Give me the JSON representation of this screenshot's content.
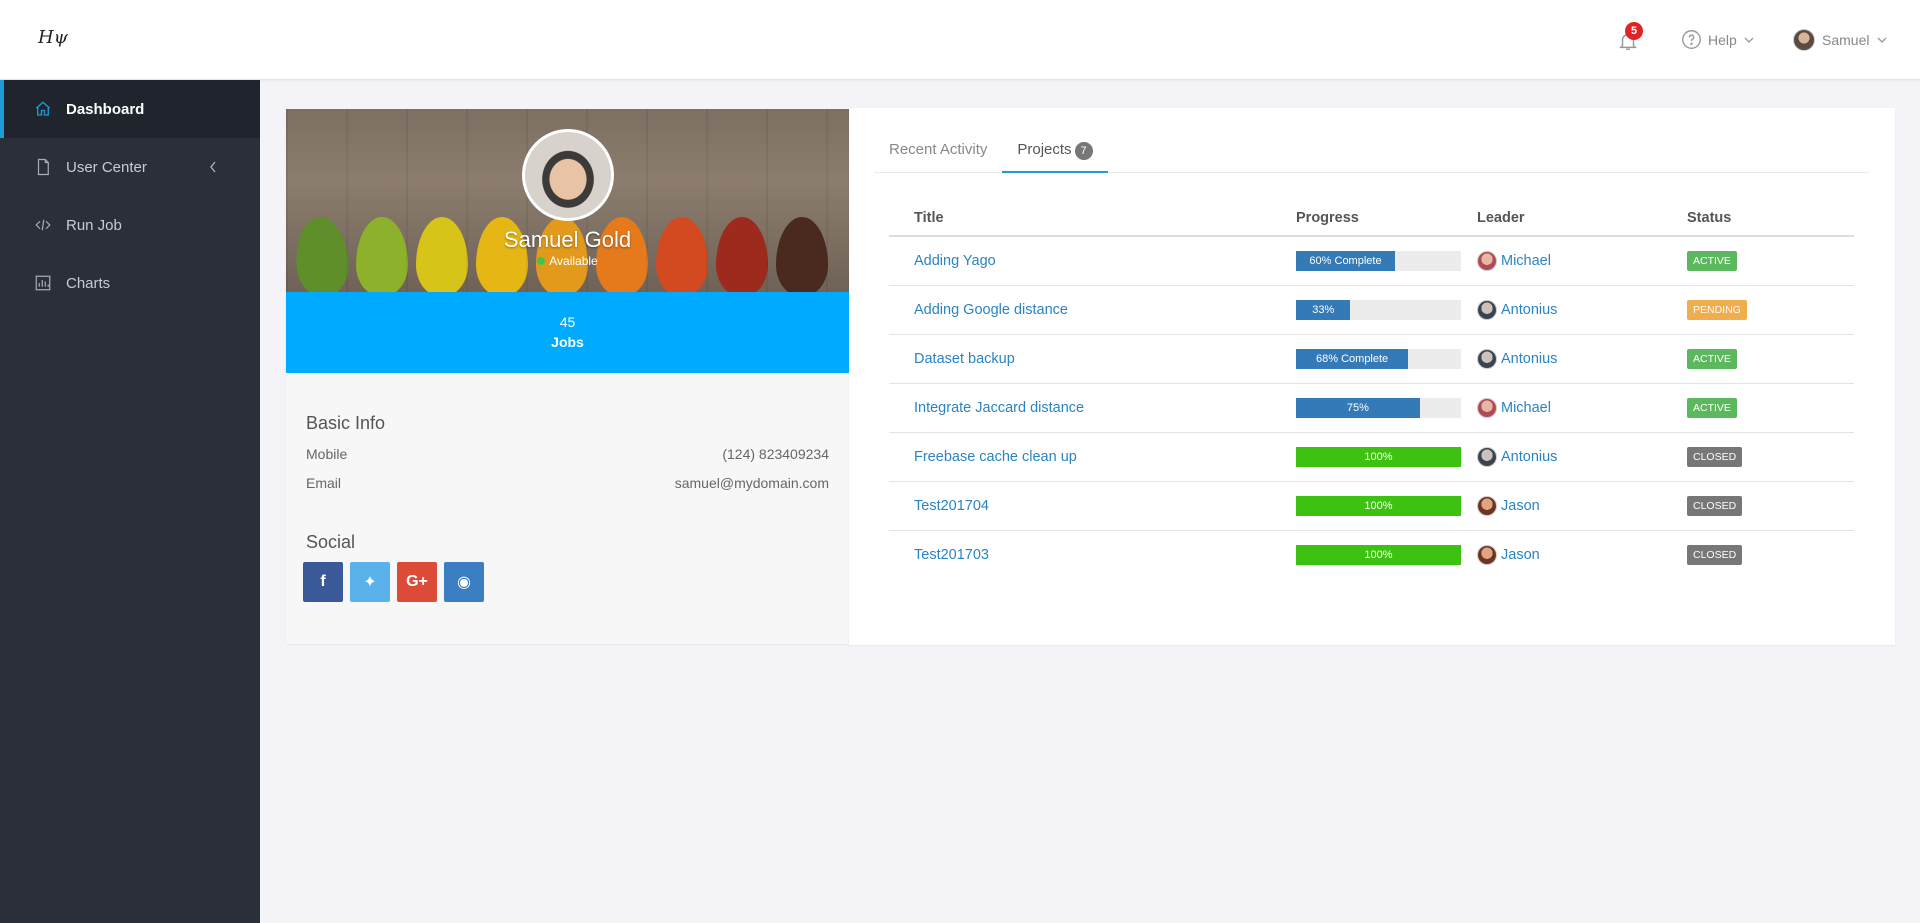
{
  "app": {
    "logo_text": "Hψ"
  },
  "topbar": {
    "notifications_count": "5",
    "help_label": "Help",
    "user_name": "Samuel"
  },
  "sidebar": {
    "items": [
      {
        "label": "Dashboard",
        "icon": "home-icon",
        "active": true
      },
      {
        "label": "User Center",
        "icon": "file-icon"
      },
      {
        "label": "Run Job",
        "icon": "code-icon"
      },
      {
        "label": "Charts",
        "icon": "chart-icon"
      }
    ]
  },
  "profile": {
    "name": "Samuel Gold",
    "status": "Available",
    "jobs_count": "45",
    "jobs_label": "Jobs",
    "basic_info_heading": "Basic Info",
    "mobile_label": "Mobile",
    "mobile_value": "(124) 823409234",
    "email_label": "Email",
    "email_value": "samuel@mydomain.com",
    "social_heading": "Social",
    "social": [
      {
        "icon": "facebook-icon",
        "glyph": "f",
        "color": "#3b5998"
      },
      {
        "icon": "twitter-icon",
        "glyph": "✦",
        "color": "#5bb2ea"
      },
      {
        "icon": "google-plus-icon",
        "glyph": "G+",
        "color": "#dc4a38"
      },
      {
        "icon": "github-icon",
        "glyph": "◉",
        "color": "#3c7ec2"
      }
    ]
  },
  "tabs": [
    {
      "label": "Recent Activity"
    },
    {
      "label": "Projects",
      "count": "7",
      "active": true
    }
  ],
  "table": {
    "headers": [
      "Title",
      "Progress",
      "Leader",
      "Status"
    ],
    "rows": [
      {
        "title": "Adding Yago",
        "progress": 60,
        "progress_label": "60% Complete",
        "bar_color": "#337ab7",
        "leader": "Michael",
        "status": "ACTIVE",
        "status_color": "#5cb85c"
      },
      {
        "title": "Adding Google distance",
        "progress": 33,
        "progress_label": "33%",
        "bar_color": "#337ab7",
        "leader": "Antonius",
        "status": "PENDING",
        "status_color": "#f0ad4e"
      },
      {
        "title": "Dataset backup",
        "progress": 68,
        "progress_label": "68% Complete",
        "bar_color": "#337ab7",
        "leader": "Antonius",
        "status": "ACTIVE",
        "status_color": "#5cb85c"
      },
      {
        "title": "Integrate Jaccard distance",
        "progress": 75,
        "progress_label": "75%",
        "bar_color": "#337ab7",
        "leader": "Michael",
        "status": "ACTIVE",
        "status_color": "#5cb85c"
      },
      {
        "title": "Freebase cache clean up",
        "progress": 100,
        "progress_label": "100%",
        "bar_color": "#3ec212",
        "leader": "Antonius",
        "status": "CLOSED",
        "status_color": "#777777"
      },
      {
        "title": "Test201704",
        "progress": 100,
        "progress_label": "100%",
        "bar_color": "#3ec212",
        "leader": "Jason",
        "status": "CLOSED",
        "status_color": "#777777"
      },
      {
        "title": "Test201703",
        "progress": 100,
        "progress_label": "100%",
        "bar_color": "#3ec212",
        "leader": "Jason",
        "status": "CLOSED",
        "status_color": "#777777"
      }
    ]
  }
}
